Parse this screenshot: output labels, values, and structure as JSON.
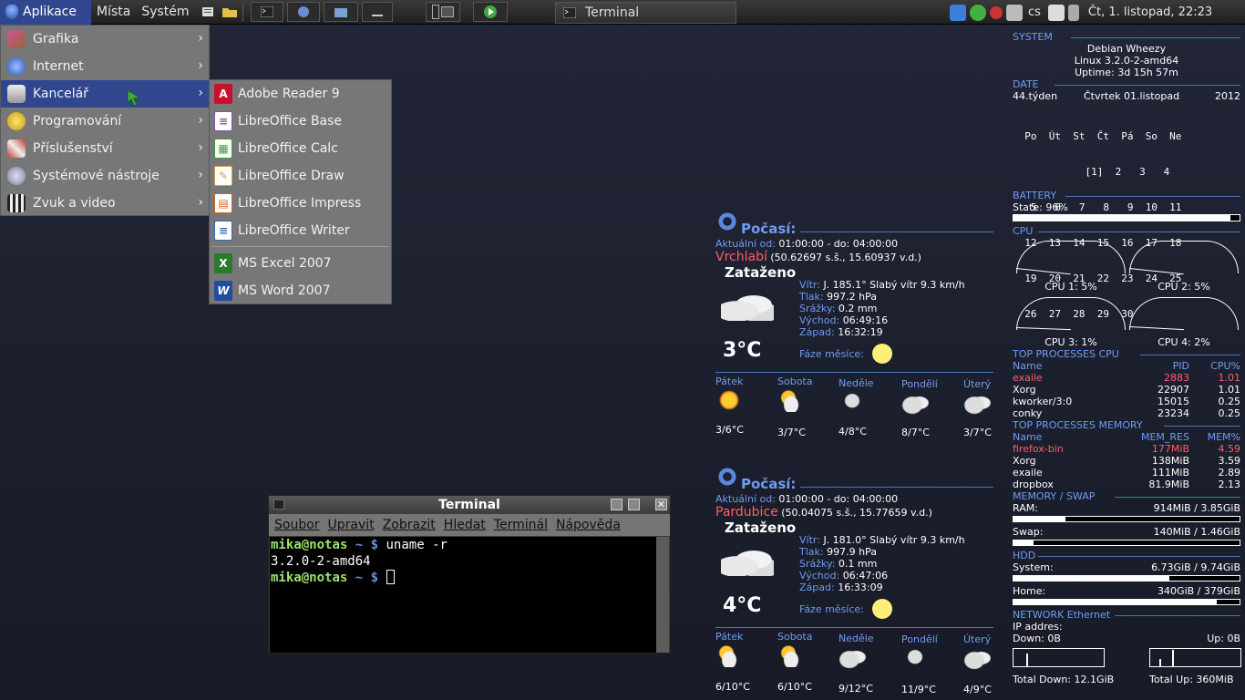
{
  "panel": {
    "menus": [
      "Aplikace",
      "Místa",
      "Systém"
    ],
    "task_terminal": "Terminal",
    "tray_lang": "cs",
    "clock": "Čt,  1. listopad, 22:23"
  },
  "menu": {
    "items": [
      {
        "label": "Grafika",
        "icon": "graphics-icon"
      },
      {
        "label": "Internet",
        "icon": "globe-icon"
      },
      {
        "label": "Kancelář",
        "icon": "office-icon"
      },
      {
        "label": "Programování",
        "icon": "programming-icon"
      },
      {
        "label": "Příslušenství",
        "icon": "accessories-icon"
      },
      {
        "label": "Systémové nástroje",
        "icon": "system-tools-icon"
      },
      {
        "label": "Zvuk a video",
        "icon": "multimedia-icon"
      }
    ],
    "submenu": [
      {
        "label": "Adobe Reader 9",
        "icon": "pdf-icon",
        "color": "#c8102e"
      },
      {
        "label": "LibreOffice Base",
        "icon": "base-icon",
        "color": "#8a4fb5"
      },
      {
        "label": "LibreOffice Calc",
        "icon": "calc-icon",
        "color": "#3c9b3c"
      },
      {
        "label": "LibreOffice Draw",
        "icon": "draw-icon",
        "color": "#d8a33a"
      },
      {
        "label": "LibreOffice Impress",
        "icon": "impress-icon",
        "color": "#d2661f"
      },
      {
        "label": "LibreOffice Writer",
        "icon": "writer-icon",
        "color": "#2f6bb5"
      },
      {
        "label": "MS Excel 2007",
        "icon": "excel-icon",
        "color": "#2a7a2a"
      },
      {
        "label": "MS Word 2007",
        "icon": "word-icon",
        "color": "#1f4ea0"
      }
    ]
  },
  "terminal": {
    "title": "Terminal",
    "menu": [
      "Soubor",
      "Upravit",
      "Zobrazit",
      "Hledat",
      "Terminál",
      "Nápověda"
    ],
    "user": "mika",
    "host": "notas",
    "path": "~",
    "cmd": "uname -r",
    "output": "3.2.0-2-amd64"
  },
  "weather": [
    {
      "title": "Počasí:",
      "updated_label": "Aktuální od:",
      "updated_value": "01:00:00 - do: 04:00:00",
      "city": "Vrchlabí",
      "coords": "(50.62697 s.š., 15.60937 v.d.)",
      "condition": "Zataženo",
      "temp": "3°C",
      "wind_label": "Vítr:",
      "wind": "J. 185.1° Slabý vítr 9.3 km/h",
      "pressure_label": "Tlak:",
      "pressure": "997.2 hPa",
      "precip_label": "Srážky:",
      "precip": "0.2 mm",
      "sunrise_label": "Východ:",
      "sunrise": "06:49:16",
      "sunset_label": "Západ:",
      "sunset": "16:32:19",
      "moon_label": "Fáze měsíce:",
      "forecast": [
        {
          "day": "Pátek",
          "temp": "3/6°C",
          "icon": "sun-icon"
        },
        {
          "day": "Sobota",
          "temp": "3/7°C",
          "icon": "sun-rain-cloud-icon"
        },
        {
          "day": "Neděle",
          "temp": "4/8°C",
          "icon": "rain-cloud-icon"
        },
        {
          "day": "Pondělí",
          "temp": "8/7°C",
          "icon": "cloud-icon"
        },
        {
          "day": "Úterý",
          "temp": "3/7°C",
          "icon": "cloud-icon"
        }
      ]
    },
    {
      "title": "Počasí:",
      "updated_label": "Aktuální od:",
      "updated_value": "01:00:00 - do: 04:00:00",
      "city": "Pardubice",
      "coords": "(50.04075 s.š., 15.77659 v.d.)",
      "condition": "Zataženo",
      "temp": "4°C",
      "wind_label": "Vítr:",
      "wind": "J. 181.0° Slabý vítr 9.3 km/h",
      "pressure_label": "Tlak:",
      "pressure": "997.9 hPa",
      "precip_label": "Srážky:",
      "precip": "0.1 mm",
      "sunrise_label": "Východ:",
      "sunrise": "06:47:06",
      "sunset_label": "Západ:",
      "sunset": "16:33:09",
      "moon_label": "Fáze měsíce:",
      "forecast": [
        {
          "day": "Pátek",
          "temp": "6/10°C",
          "icon": "sun-cloud-icon"
        },
        {
          "day": "Sobota",
          "temp": "6/10°C",
          "icon": "sun-cloud-icon"
        },
        {
          "day": "Neděle",
          "temp": "9/12°C",
          "icon": "cloud-icon"
        },
        {
          "day": "Pondělí",
          "temp": "11/9°C",
          "icon": "rain-cloud-icon"
        },
        {
          "day": "Úterý",
          "temp": "4/9°C",
          "icon": "cloud-icon"
        }
      ]
    }
  ],
  "conky": {
    "system_label": "SYSTEM",
    "distro": "Debian Wheezy",
    "kernel": "Linux 3.2.0-2-amd64",
    "uptime": "Uptime: 3d 15h 57m",
    "date_label": "DATE",
    "week": "44.týden",
    "date": "Čtvrtek 01.listopad",
    "year": "2012",
    "calendar": [
      "  Po  Út  St  Čt  Pá  So  Ne",
      "            [1]  2   3   4",
      "   5   6   7   8   9  10  11",
      "  12  13  14  15  16  17  18",
      "  19  20  21  22  23  24  25",
      "  26  27  28  29  30"
    ],
    "battery_label": "BATTERY",
    "battery_state": "State: 96%",
    "battery_level": 0.96,
    "cpu_label": "CPU",
    "cpus": [
      {
        "label": "CPU 1: 5%",
        "value": 5
      },
      {
        "label": "CPU 2: 5%",
        "value": 5
      },
      {
        "label": "CPU 3: 1%",
        "value": 1
      },
      {
        "label": "CPU 4: 2%",
        "value": 2
      }
    ],
    "top_cpu_label": "TOP PROCESSES CPU",
    "top_cpu_headers": [
      "Name",
      "PID",
      "CPU%"
    ],
    "top_cpu": [
      {
        "name": "exaile",
        "pid": "2883",
        "val": "1.01"
      },
      {
        "name": "Xorg",
        "pid": "22907",
        "val": "1.01"
      },
      {
        "name": "kworker/3:0",
        "pid": "15015",
        "val": "0.25"
      },
      {
        "name": "conky",
        "pid": "23234",
        "val": "0.25"
      }
    ],
    "top_mem_label": "TOP PROCESSES MEMORY",
    "top_mem_headers": [
      "Name",
      "MEM_RES",
      "MEM%"
    ],
    "top_mem": [
      {
        "name": "firefox-bin",
        "res": "177MiB",
        "val": "4.59"
      },
      {
        "name": "Xorg",
        "res": "138MiB",
        "val": "3.59"
      },
      {
        "name": "exaile",
        "res": "111MiB",
        "val": "2.89"
      },
      {
        "name": "dropbox",
        "res": "81.9MiB",
        "val": "2.13"
      }
    ],
    "mem_label": "MEMORY / SWAP",
    "ram_label": "RAM:",
    "ram_value": "914MiB  / 3.85GiB",
    "ram_level": 0.23,
    "swap_label": "Swap:",
    "swap_value": "140MiB  / 1.46GiB",
    "swap_level": 0.09,
    "hdd_label": "HDD",
    "hdd_system_label": "System:",
    "hdd_system_value": "6.73GiB / 9.74GiB",
    "hdd_system_level": 0.69,
    "hdd_home_label": "Home:",
    "hdd_home_value": "340GiB  / 379GiB",
    "hdd_home_level": 0.9,
    "net_label": "NETWORK Ethernet",
    "ip_label": "IP addres:",
    "down": "Down: 0B",
    "up": "Up: 0B",
    "total_down": "Total Down: 12.1GiB",
    "total_up": "Total Up: 360MiB"
  }
}
